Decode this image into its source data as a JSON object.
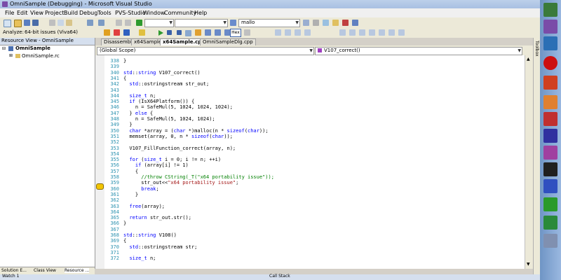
{
  "window": {
    "title": "OmniSample (Debugging) - Microsoft Visual Studio"
  },
  "menu": [
    "File",
    "Edit",
    "View",
    "Project",
    "Build",
    "Debug",
    "Tools",
    "PVS-Studio",
    "Window",
    "Community",
    "Help"
  ],
  "toolbar": {
    "search_value": "mallo",
    "analyze_label": "Analyze:",
    "analyze_value": "64-bit issues (Viva64)",
    "hex_label": "Hex"
  },
  "resource_view": {
    "title": "Resource View - OmniSample",
    "root": "OmniSample",
    "child": "OmniSample.rc",
    "bottom_tabs": [
      "Solution E...",
      "Class View",
      "Resource ..."
    ]
  },
  "doc_tabs": [
    "Disassembly",
    "x64Sample.h",
    "x64Sample.cpp",
    "OmniSampleDlg.cpp"
  ],
  "active_tab": "x64Sample.cpp",
  "nav": {
    "scope": "(Global Scope)",
    "member": "V107_correct()"
  },
  "toolbox_label": "Toolbox",
  "bottom_panes": {
    "left": "Watch 1",
    "right": "Call Stack"
  },
  "code_lines": [
    {
      "n": "338",
      "t": "}"
    },
    {
      "n": "339",
      "t": ""
    },
    {
      "n": "340",
      "t": "std::string V107_correct()"
    },
    {
      "n": "341",
      "t": "{"
    },
    {
      "n": "342",
      "t": "  std::ostringstream str_out;"
    },
    {
      "n": "343",
      "t": ""
    },
    {
      "n": "344",
      "t": "  size_t n;"
    },
    {
      "n": "345",
      "t": "  if (IsX64Platform()) {"
    },
    {
      "n": "346",
      "t": "    n = SafeMul(5, 1024, 1024, 1024);"
    },
    {
      "n": "347",
      "t": "  } else {"
    },
    {
      "n": "348",
      "t": "    n = SafeMul(5, 1024, 1024);"
    },
    {
      "n": "349",
      "t": "  }"
    },
    {
      "n": "350",
      "t": "  char *array = (char *)malloc(n * sizeof(char));"
    },
    {
      "n": "351",
      "t": "  memset(array, 0, n * sizeof(char));"
    },
    {
      "n": "352",
      "t": ""
    },
    {
      "n": "353",
      "t": "  V107_FillFunction_correct(array, n);"
    },
    {
      "n": "354",
      "t": ""
    },
    {
      "n": "355",
      "t": "  for (size_t i = 0; i != n; ++i)"
    },
    {
      "n": "356",
      "t": "    if (array[i] != 1)"
    },
    {
      "n": "357",
      "t": "    {"
    },
    {
      "n": "358",
      "t": "      //throw CString(_T(\"x64 portability issue\"));"
    },
    {
      "n": "359",
      "t": "      str_out<<\"x64 portability issue\";"
    },
    {
      "n": "360",
      "t": "      break;"
    },
    {
      "n": "361",
      "t": "    }"
    },
    {
      "n": "362",
      "t": ""
    },
    {
      "n": "363",
      "t": "  free(array);"
    },
    {
      "n": "364",
      "t": ""
    },
    {
      "n": "365",
      "t": "  return str_out.str();"
    },
    {
      "n": "366",
      "t": "}"
    },
    {
      "n": "367",
      "t": ""
    },
    {
      "n": "368",
      "t": "std::string V108()"
    },
    {
      "n": "369",
      "t": "{"
    },
    {
      "n": "370",
      "t": "  std::ostringstream str;"
    },
    {
      "n": "371",
      "t": ""
    },
    {
      "n": "372",
      "t": "  size_t n;"
    }
  ],
  "current_line": "359",
  "colors": {
    "title_bar": "#a9c0e2",
    "accent": "#d5dfee",
    "keyword": "#0000ff",
    "comment": "#008000",
    "string": "#a31515"
  }
}
